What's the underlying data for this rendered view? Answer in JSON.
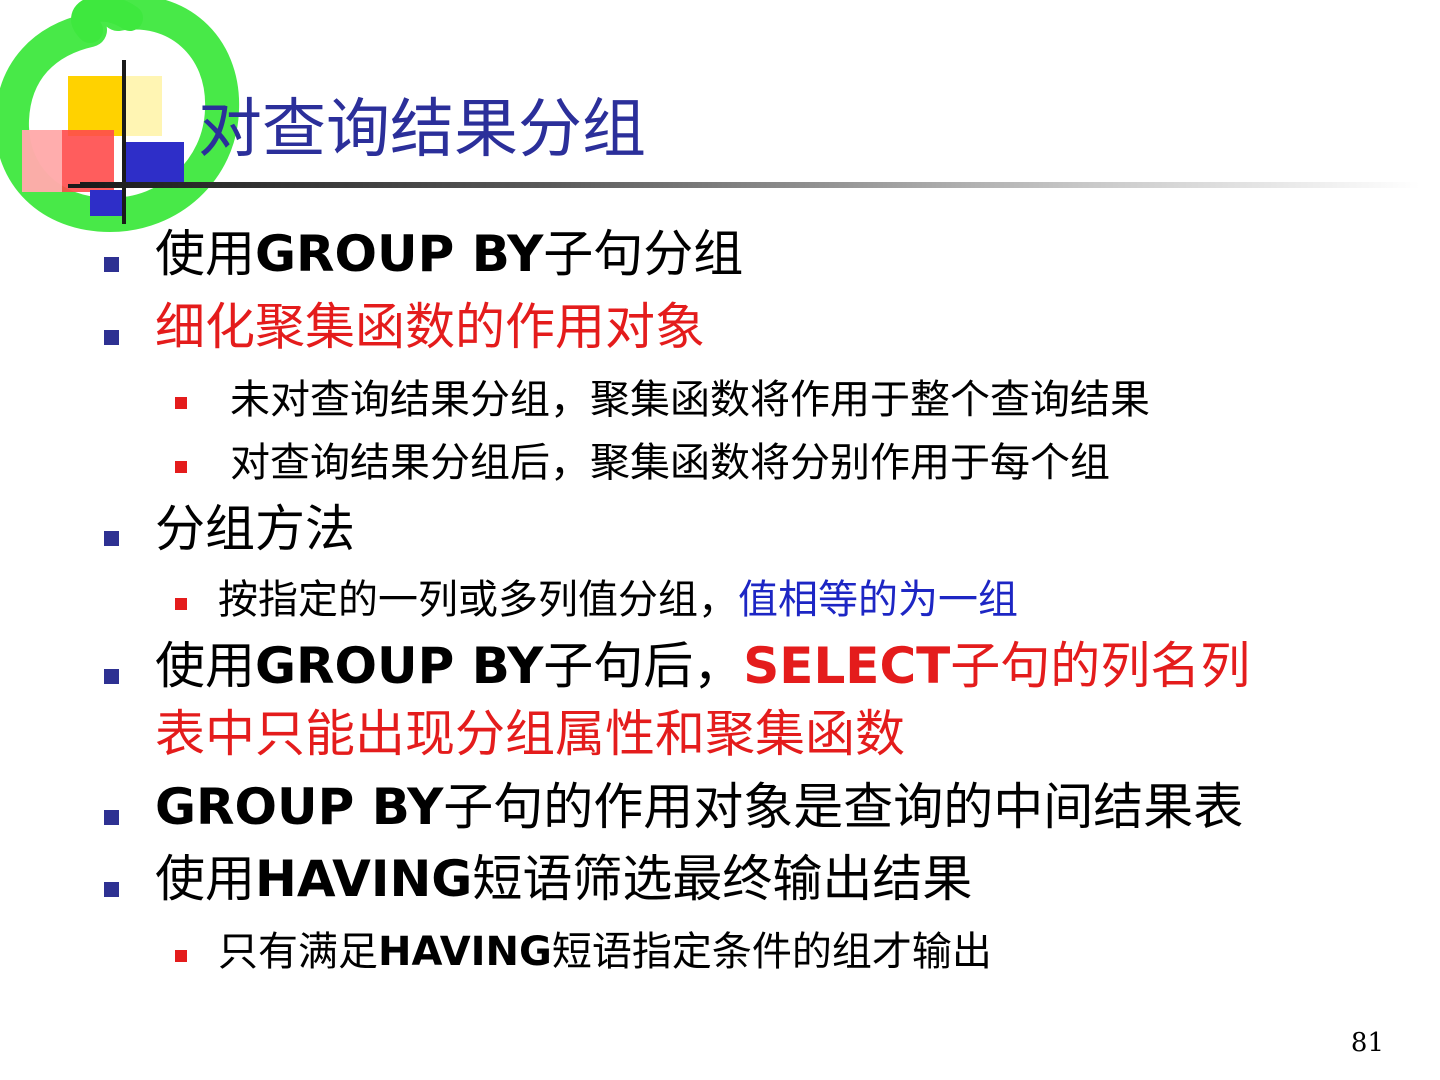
{
  "slide": {
    "title": "对查询结果分组",
    "page_number": "81"
  },
  "bullets": {
    "b1": {
      "prefix": "使用",
      "bold": "GROUP BY",
      "suffix": "子句分组"
    },
    "b2": {
      "text": "细化聚集函数的作用对象"
    },
    "b2_sub1": {
      "text": "未对查询结果分组，聚集函数将作用于整个查询结果"
    },
    "b2_sub2": {
      "text": "对查询结果分组后，聚集函数将分别作用于每个组"
    },
    "b3": {
      "text": "分组方法"
    },
    "b3_sub1": {
      "text": "按指定的一列或多列值分组，",
      "highlight": "值相等的为一组"
    },
    "b4": {
      "prefix": "使用",
      "bold": "GROUP  BY",
      "mid": "子句后，",
      "red_bold": "SELECT",
      "red_tail": "子句的列名列",
      "line2": "表中只能出现分组属性和聚集函数"
    },
    "b5": {
      "bold": "GROUP BY",
      "suffix": "子句的作用对象是查询的中间结果表"
    },
    "b6": {
      "prefix": "使用",
      "bold": "HAVING",
      "suffix": "短语筛选最终输出结果"
    },
    "b6_sub1": {
      "prefix": "只有满足",
      "bold": "HAVING",
      "suffix": "短语指定条件的组才输出"
    }
  },
  "colors": {
    "title": "#2b2f9a",
    "bullet_level1": "#2e3192",
    "bullet_level2": "#e41c1c",
    "emphasis_red": "#e41c1c",
    "emphasis_blue": "#1d26c4",
    "logo_green": "#3ee83e"
  },
  "icons": {
    "logo": "green-ring-color-block-logo"
  }
}
